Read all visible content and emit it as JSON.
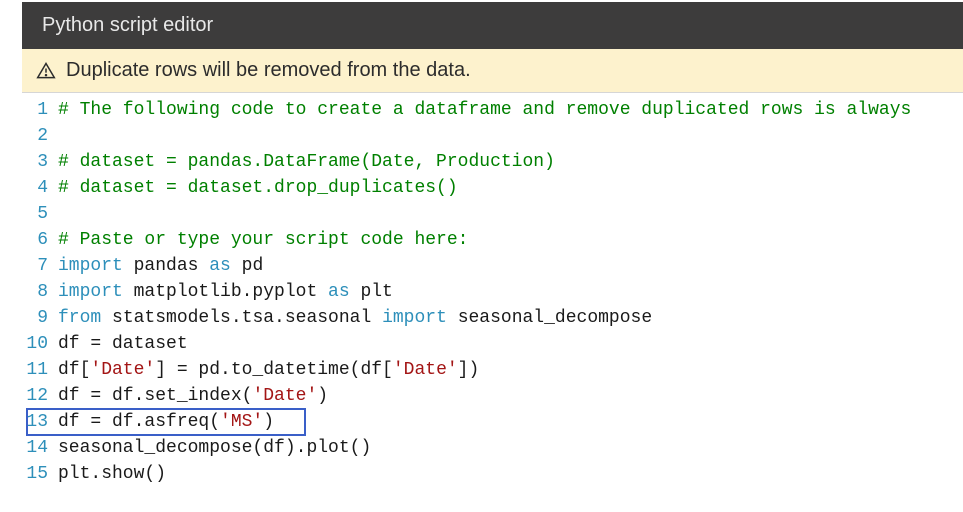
{
  "header": {
    "title": "Python script editor"
  },
  "warning": {
    "text": "Duplicate rows will be removed from the data."
  },
  "editor": {
    "highlighted_line": 13,
    "lines": [
      {
        "n": 1,
        "tokens": [
          {
            "t": "# The following code to create a dataframe and remove duplicated rows is always",
            "c": "c-comment"
          }
        ]
      },
      {
        "n": 2,
        "tokens": []
      },
      {
        "n": 3,
        "tokens": [
          {
            "t": "# dataset = pandas.DataFrame(Date, Production)",
            "c": "c-comment"
          }
        ]
      },
      {
        "n": 4,
        "tokens": [
          {
            "t": "# dataset = dataset.drop_duplicates()",
            "c": "c-comment"
          }
        ]
      },
      {
        "n": 5,
        "tokens": []
      },
      {
        "n": 6,
        "tokens": [
          {
            "t": "# Paste or type your script code here:",
            "c": "c-comment"
          }
        ]
      },
      {
        "n": 7,
        "tokens": [
          {
            "t": "import",
            "c": "c-keyword"
          },
          {
            "t": " pandas "
          },
          {
            "t": "as",
            "c": "c-keyword"
          },
          {
            "t": " pd"
          }
        ]
      },
      {
        "n": 8,
        "tokens": [
          {
            "t": "import",
            "c": "c-keyword"
          },
          {
            "t": " matplotlib.pyplot "
          },
          {
            "t": "as",
            "c": "c-keyword"
          },
          {
            "t": " plt"
          }
        ]
      },
      {
        "n": 9,
        "tokens": [
          {
            "t": "from",
            "c": "c-keyword"
          },
          {
            "t": " statsmodels.tsa.seasonal "
          },
          {
            "t": "import",
            "c": "c-keyword"
          },
          {
            "t": " seasonal_decompose"
          }
        ]
      },
      {
        "n": 10,
        "tokens": [
          {
            "t": "df = dataset"
          }
        ]
      },
      {
        "n": 11,
        "tokens": [
          {
            "t": "df["
          },
          {
            "t": "'Date'",
            "c": "c-string"
          },
          {
            "t": "] = pd.to_datetime(df["
          },
          {
            "t": "'Date'",
            "c": "c-string"
          },
          {
            "t": "])"
          }
        ]
      },
      {
        "n": 12,
        "tokens": [
          {
            "t": "df = df.set_index("
          },
          {
            "t": "'Date'",
            "c": "c-string"
          },
          {
            "t": ")"
          }
        ]
      },
      {
        "n": 13,
        "tokens": [
          {
            "t": "df = df.asfreq("
          },
          {
            "t": "'MS'",
            "c": "c-string"
          },
          {
            "t": ")"
          }
        ]
      },
      {
        "n": 14,
        "tokens": [
          {
            "t": "seasonal_decompose(df).plot()"
          }
        ]
      },
      {
        "n": 15,
        "tokens": [
          {
            "t": "plt.show()"
          }
        ]
      }
    ]
  }
}
